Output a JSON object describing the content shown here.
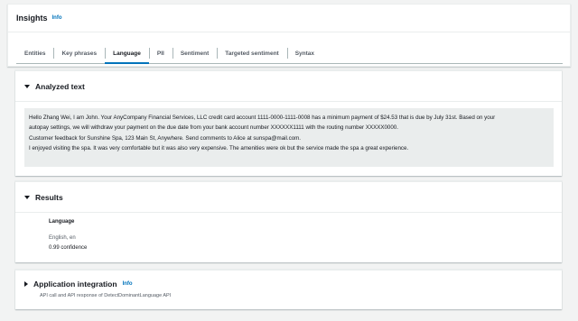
{
  "insights": {
    "title": "Insights",
    "info_label": "Info",
    "tabs": [
      {
        "label": "Entities",
        "active": false
      },
      {
        "label": "Key phrases",
        "active": false
      },
      {
        "label": "Language",
        "active": true
      },
      {
        "label": "PII",
        "active": false
      },
      {
        "label": "Sentiment",
        "active": false
      },
      {
        "label": "Targeted sentiment",
        "active": false
      },
      {
        "label": "Syntax",
        "active": false
      }
    ]
  },
  "analyzed_text": {
    "title": "Analyzed text",
    "lines": [
      "Hello Zhang Wei, I am John. Your AnyCompany Financial Services, LLC credit card account 1111-0000-1111-0008 has a minimum payment of $24.53 that is due by July 31st. Based on your",
      "autopay settings, we will withdraw your payment on the due date from your bank account number XXXXXX1111 with the routing number XXXXX0000.",
      "Customer feedback for Sunshine Spa, 123 Main St, Anywhere. Send comments to Alice at sunspa@mail.com.",
      "I enjoyed visiting the spa. It was very comfortable but it was also very expensive. The amenities were ok but the service made the spa a great experience."
    ]
  },
  "results": {
    "title": "Results",
    "field_label": "Language",
    "language_value": "English, en",
    "confidence_value": "0.99 confidence"
  },
  "integration": {
    "title": "Application integration",
    "info_label": "Info",
    "subtitle": "API call and API response of DetectDominantLanguage API"
  },
  "colors": {
    "accent": "#0073bb",
    "background": "#f2f3f3",
    "text_box": "#eaeded"
  }
}
